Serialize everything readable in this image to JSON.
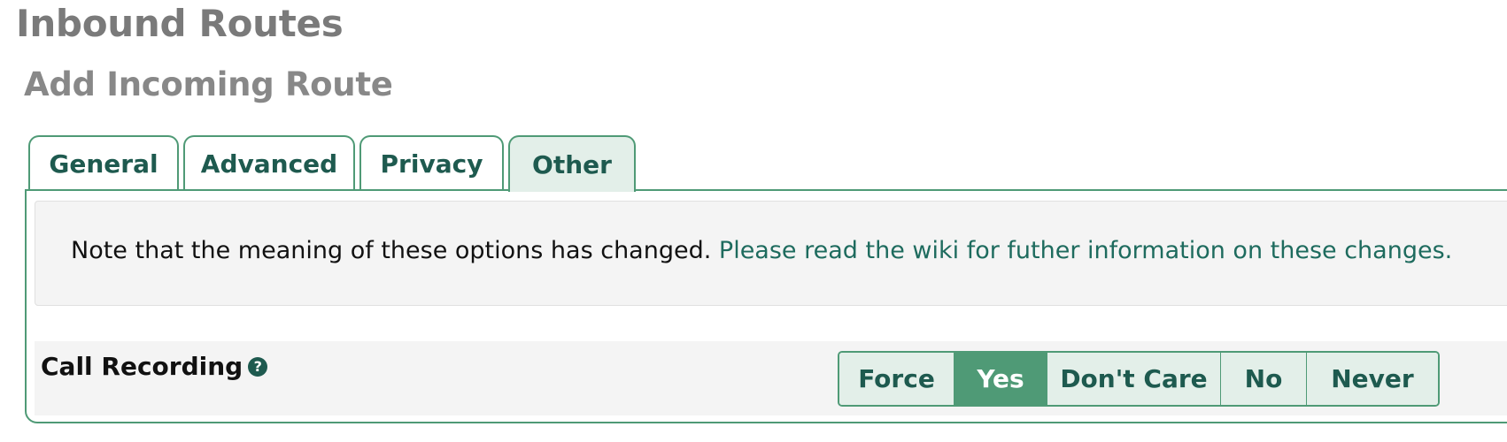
{
  "page": {
    "title": "Inbound Routes",
    "section_title": "Add Incoming Route"
  },
  "tabs": [
    {
      "label": "General",
      "active": false
    },
    {
      "label": "Advanced",
      "active": false
    },
    {
      "label": "Privacy",
      "active": false
    },
    {
      "label": "Other",
      "active": true
    }
  ],
  "note": {
    "text": "Note that the meaning of these options has changed.",
    "link_text": "Please read the wiki for futher information on these changes."
  },
  "call_recording": {
    "label": "Call Recording",
    "help_icon": "question-circle-icon",
    "options": [
      "Force",
      "Yes",
      "Don't Care",
      "No",
      "Never"
    ],
    "selected": "Yes"
  },
  "colors": {
    "accent": "#4f9a76",
    "accent_text": "#1e5a4f",
    "tab_active_bg": "#e3efe9",
    "title_gray": "#7a7a7a"
  }
}
